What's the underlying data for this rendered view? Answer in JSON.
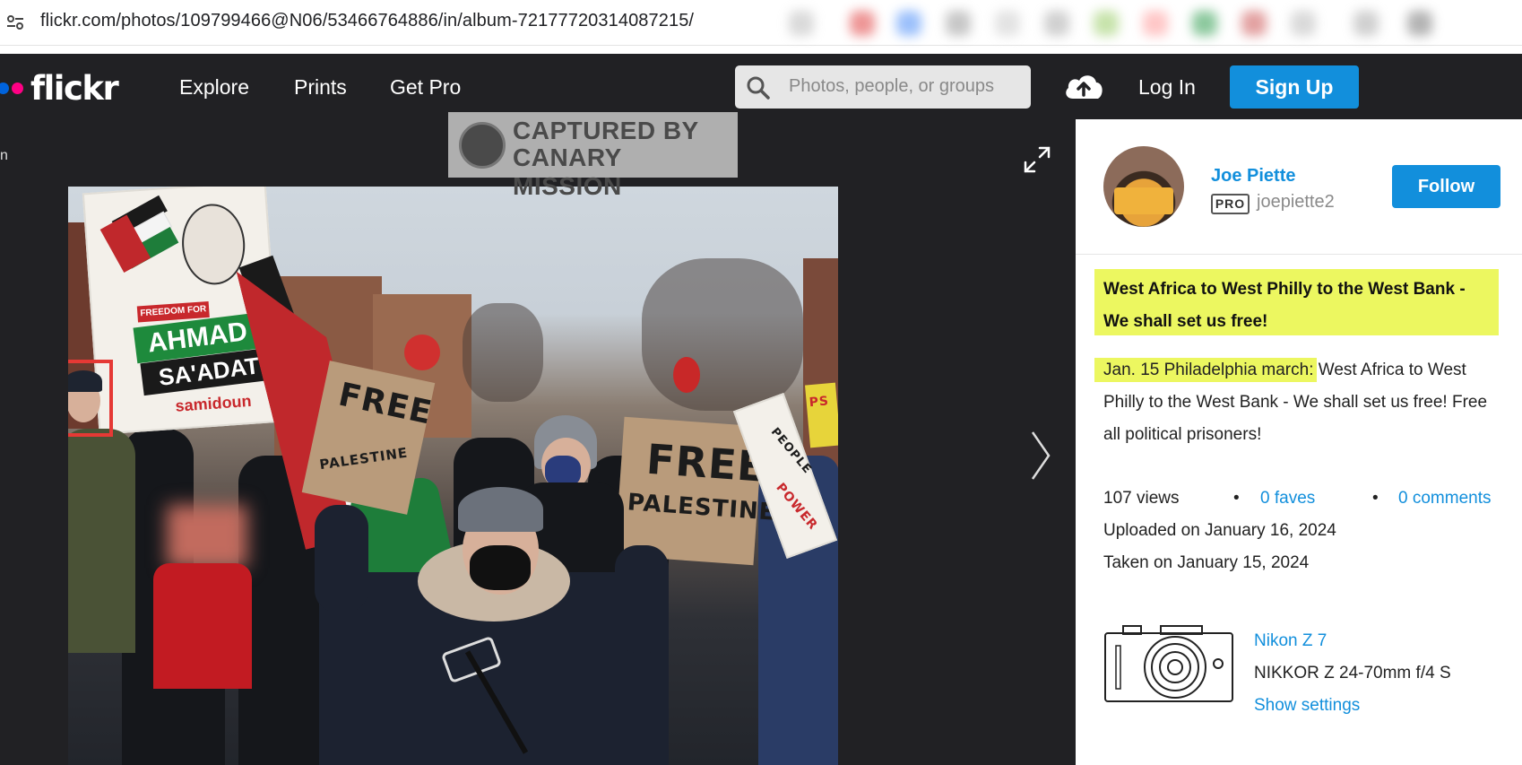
{
  "browser": {
    "url": "flickr.com/photos/109799466@N06/53466764886/in/album-72177720314087215/"
  },
  "header": {
    "logo": "flickr",
    "nav": [
      "Explore",
      "Prints",
      "Get Pro"
    ],
    "search_placeholder": "Photos, people, or groups",
    "login": "Log In",
    "signup": "Sign Up",
    "colors": {
      "bar": "#212124",
      "accent": "#128fdc",
      "logo_blue": "#0063dc",
      "logo_pink": "#ff0084"
    }
  },
  "photo": {
    "edge_label": "n",
    "watermark": {
      "line1": "CAPTURED BY",
      "line2": "CANARY MISSION"
    },
    "signs": {
      "freedom": "FREEDOM FOR",
      "ahmad": "AHMAD",
      "saadat": "SA'ADAT",
      "samidoun": "samidoun",
      "free1": "FREE",
      "palestine1": "PALESTINE",
      "free2": "FREE",
      "palestine2": "PALESTINE",
      "people": "PEOPLE",
      "power": "POWER",
      "ps": "PS"
    }
  },
  "sidebar": {
    "owner_name": "Joe Piette",
    "pro_badge": "PRO",
    "username": "joepiette2",
    "follow": "Follow",
    "title": "West Africa to West Philly to the West Bank - We shall set us free!",
    "description_highlight": "Jan. 15 Philadelphia march:",
    "description_rest": " West Africa to West Philly to the West Bank - We shall set us free! Free all political prisoners!",
    "stats": {
      "views": "107 views",
      "bullet": "•",
      "faves": "0 faves",
      "comments": "0 comments"
    },
    "uploaded": "Uploaded on January 16, 2024",
    "taken": "Taken on January 15, 2024",
    "camera": {
      "model": "Nikon Z 7",
      "lens": "NIKKOR Z 24-70mm f/4 S",
      "settings": "Show settings"
    },
    "highlight_color": "#ecf760"
  }
}
